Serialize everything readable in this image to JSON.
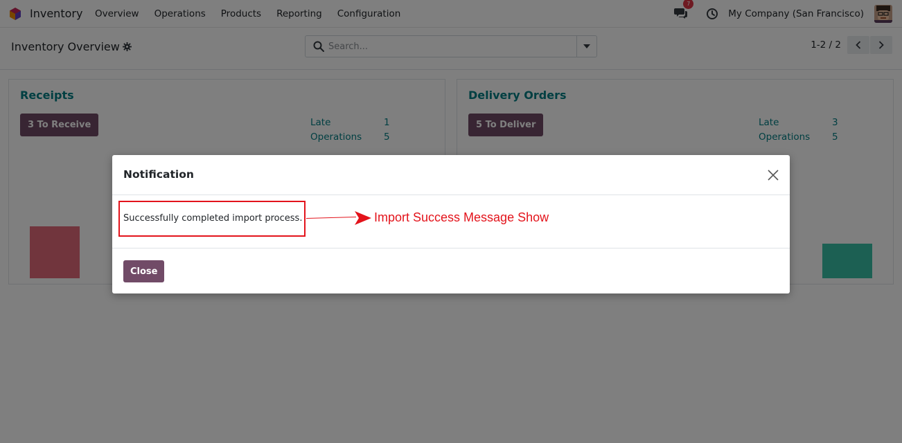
{
  "navbar": {
    "app_name": "Inventory",
    "app_icon": "inventory-logo-icon",
    "menu": [
      "Overview",
      "Operations",
      "Products",
      "Reporting",
      "Configuration"
    ],
    "messages_badge": "7",
    "company": "My Company (San Francisco)"
  },
  "control_panel": {
    "title": "Inventory Overview",
    "search_placeholder": "Search...",
    "pager": "1-2 / 2"
  },
  "dashboard": {
    "receipts": {
      "title": "Receipts",
      "button": "3 To Receive",
      "stats": [
        {
          "label": "Late",
          "value": "1"
        },
        {
          "label": "Operations",
          "value": "5"
        }
      ]
    },
    "delivery": {
      "title": "Delivery Orders",
      "button": "5 To Deliver",
      "stats": [
        {
          "label": "Late",
          "value": "3"
        },
        {
          "label": "Operations",
          "value": "5"
        }
      ]
    }
  },
  "modal": {
    "title": "Notification",
    "message": "Successfully completed import process.",
    "annotation": "Import Success Message Show",
    "close_label": "Close"
  },
  "colors": {
    "primary": "#714b67",
    "accent": "#017e84",
    "annotation": "#e3131b",
    "bar_late": "#e36a7a",
    "bar_ready": "#38c0a6"
  }
}
